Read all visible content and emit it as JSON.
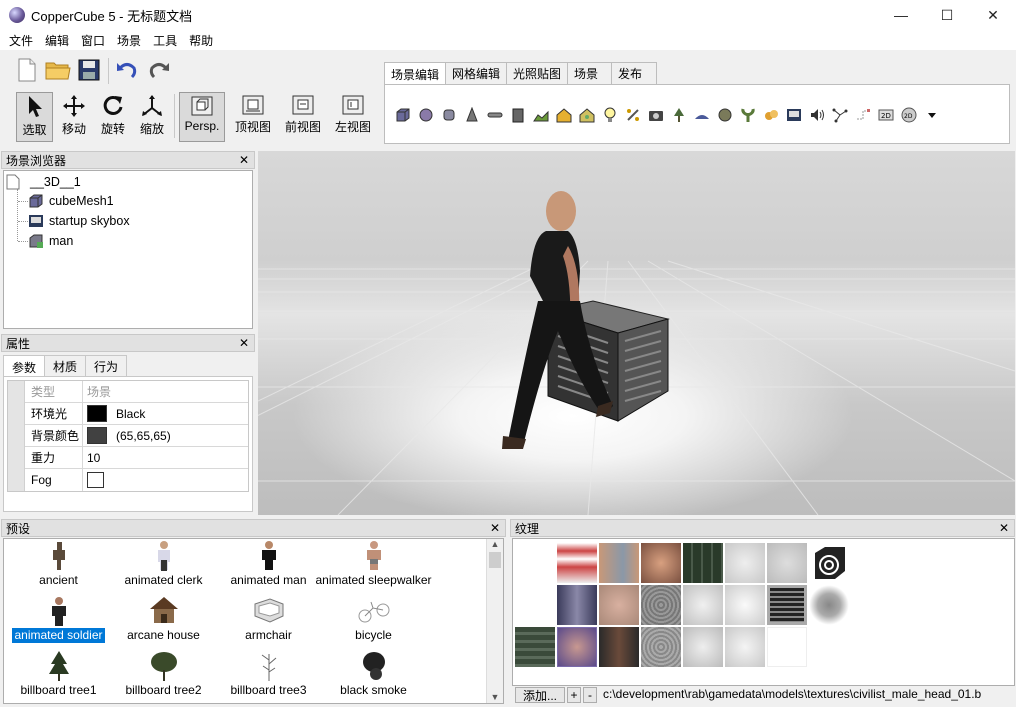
{
  "window": {
    "title": "CopperCube 5 - 无标题文档",
    "minimize": "—",
    "maximize": "☐",
    "close": "✕"
  },
  "menu": [
    "文件",
    "编辑",
    "窗口",
    "场景",
    "工具",
    "帮助"
  ],
  "toolbar": {
    "tools": [
      {
        "label": "选取",
        "icon": "select-arrow-icon",
        "active": true
      },
      {
        "label": "移动",
        "icon": "move-icon",
        "active": false
      },
      {
        "label": "旋转",
        "icon": "rotate-icon",
        "active": false
      },
      {
        "label": "缩放",
        "icon": "scale-icon",
        "active": false
      }
    ],
    "views": [
      {
        "label": "Persp.",
        "active": true
      },
      {
        "label": "顶视图",
        "active": false
      },
      {
        "label": "前视图",
        "active": false
      },
      {
        "label": "左视图",
        "active": false
      }
    ]
  },
  "tool_tabs": [
    {
      "label": "场景编辑",
      "active": true
    },
    {
      "label": "网格编辑",
      "active": false
    },
    {
      "label": "光照贴图",
      "active": false
    },
    {
      "label": "场景",
      "active": false
    },
    {
      "label": "发布",
      "active": false
    }
  ],
  "tool_icons": [
    "cube-icon",
    "sphere-icon",
    "cylinder-icon",
    "cone-icon",
    "plane-icon",
    "box-icon",
    "terrain-icon",
    "house-icon",
    "house2-icon",
    "light-icon",
    "particle-icon",
    "camera-icon",
    "tree-icon",
    "water-icon",
    "mesh-icon",
    "plant-icon",
    "sound-blob-icon",
    "skybox-icon",
    "speaker-icon",
    "path-icon",
    "connector-icon",
    "overlay-2d-icon",
    "3d-icon",
    "dropdown-icon"
  ],
  "scene_browser": {
    "title": "场景浏览器",
    "root": "__3D__1",
    "items": [
      "cubeMesh1",
      "startup skybox",
      "man"
    ]
  },
  "properties": {
    "title": "属性",
    "tabs": [
      "参数",
      "材质",
      "行为"
    ],
    "header": {
      "name": "类型",
      "value": "场景"
    },
    "rows": [
      {
        "name": "环境光",
        "value": "Black",
        "swatch": "#000000"
      },
      {
        "name": "背景颜色",
        "value": "(65,65,65)",
        "swatch": "#414141"
      },
      {
        "name": "重力",
        "value": "10",
        "swatch": ""
      },
      {
        "name": "Fog",
        "value": "",
        "swatch": "checkbox"
      }
    ]
  },
  "presets": {
    "title": "预设",
    "items": [
      "ancient",
      "animated clerk",
      "animated man",
      "animated sleepwalker",
      "animated soldier",
      "arcane house",
      "armchair",
      "bicycle",
      "billboard tree1",
      "billboard tree2",
      "billboard tree3",
      "black smoke"
    ],
    "selected": "animated soldier"
  },
  "textures": {
    "title": "纹理",
    "add_label": "添加...",
    "plus": "+",
    "minus": "-",
    "path": "c:\\development\\rab\\gamedata\\models\\textures\\civilist_male_head_01.b"
  },
  "colors": {
    "selection": "#0078d7",
    "panel_header": "#e1e1e1"
  }
}
